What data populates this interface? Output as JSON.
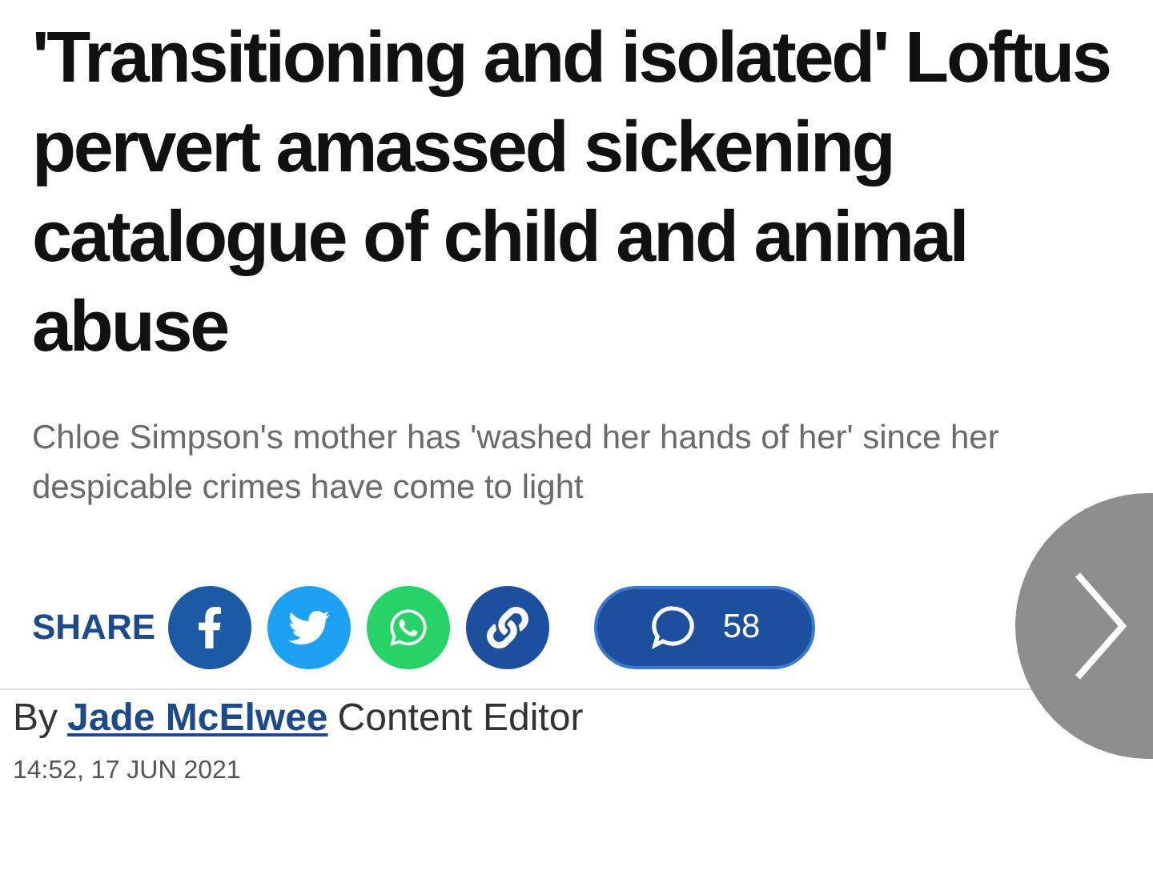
{
  "headline": "'Transitioning and isolated' Loftus pervert amassed sickening catalogue of child and animal abuse",
  "standfirst": "Chloe Simpson's mother has 'washed her hands of her' since her despicable crimes have come to light",
  "share": {
    "label": "SHARE",
    "buttons": [
      {
        "kind": "facebook"
      },
      {
        "kind": "twitter"
      },
      {
        "kind": "whatsapp"
      },
      {
        "kind": "link"
      }
    ]
  },
  "comments": {
    "count": "58"
  },
  "byline": {
    "prefix": "By",
    "author": "Jade McElwee",
    "role": "Content Editor"
  },
  "timestamp": "14:52, 17 JUN 2021"
}
